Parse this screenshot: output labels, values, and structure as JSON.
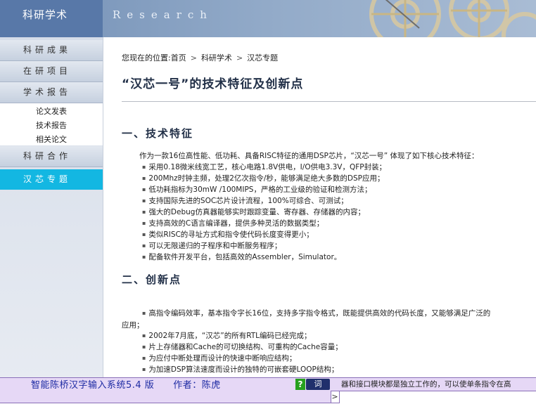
{
  "header": {
    "brand": "科研学术",
    "banner_text": "Research"
  },
  "sidebar": {
    "items": [
      {
        "label": "科研成果"
      },
      {
        "label": "在研项目"
      },
      {
        "label": "学术报告"
      },
      {
        "label": "科研合作"
      },
      {
        "label": "汉芯专题"
      }
    ],
    "sub_items": [
      "论文发表",
      "技术报告",
      "相关论文"
    ],
    "active": "汉芯专题"
  },
  "breadcrumb": {
    "prefix": "您现在的位置:",
    "items": [
      "首页",
      "科研学术",
      "汉芯专题"
    ]
  },
  "article": {
    "title": "“汉芯一号”的技术特征及创新点",
    "section1": {
      "heading": "一、技术特征",
      "intro": "作为一款16位高性能、低功耗、具备RISC特征的通用DSP芯片，“汉芯一号” 体现了如下核心技术特征：",
      "bullets": [
        "采用0.18微米线宽工艺，核心电路1.8V供电，I/O供电3.3V，QFP封装；",
        "200Mhz时钟主频，处理2亿次指令/秒，能够满足绝大多数的DSP应用；",
        "低功耗指标为30mW /100MIPS，严格的工业级的验证和检测方法；",
        "支持国际先进的SOC芯片设计流程，100%可综合、可测试；",
        "强大的Debug仿真器能够实时跟踪变量、寄存器、存储器的内容；",
        "支持高效的C语言编译器，提供多种灵活的数据类型；",
        "类似RISC的寻址方式和指令使代码长度变得更小；",
        "可以无限递归的子程序和中断服务程序；",
        "配备软件开发平台，包括高效的Assembler，Simulator。"
      ]
    },
    "section2": {
      "heading": "二、创新点",
      "bullets": [
        "高指令编码效率，基本指令字长16位，支持多字指令格式，既能提供高效的代码长度，又能够满足广泛的",
        "2002年7月底，“汉芯”的所有RTL编码已经完成；",
        "片上存储器和Cache的可切换结构、可重构的Cache容量；",
        "为应付中断处理而设计的快速中断响应结构；",
        "为加速DSP算法速度而设计的独特的可嵌套硬LOOP结构；"
      ],
      "bullet1_cont": "应用；",
      "partial_line": "器和接口模块都是独立工作的，可以使单条指令在高"
    }
  },
  "ime": {
    "title": "智能陈桥汉字输入系统5.4 版　　作者：陈虎",
    "q_icon": "?",
    "dict_label": "词",
    "arrow": ">"
  },
  "colors": {
    "header_bg": "#6a86ad",
    "sidebar_active": "#13b7e2",
    "title_color": "#223048",
    "ime_bg": "#e6d8f6",
    "ime_text": "#1d2aa3"
  }
}
